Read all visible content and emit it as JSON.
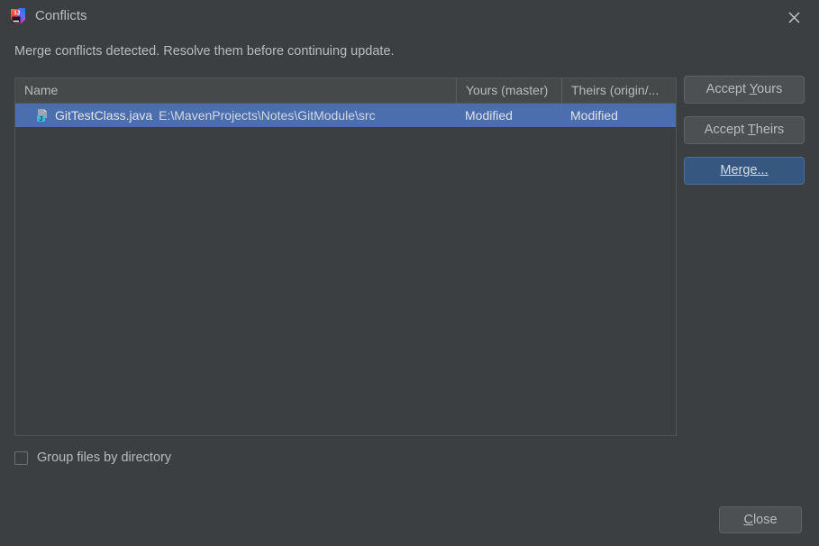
{
  "window": {
    "title": "Conflicts",
    "app_icon": "intellij-idea-icon",
    "close_icon": "close-icon"
  },
  "message": "Merge conflicts detected. Resolve them before continuing update.",
  "table": {
    "columns": [
      {
        "label": "Name"
      },
      {
        "label": "Yours (master)"
      },
      {
        "label": "Theirs (origin/..."
      }
    ],
    "rows": [
      {
        "icon": "java-file-icon",
        "file_name": "GitTestClass.java",
        "file_path": "E:\\MavenProjects\\Notes\\GitModule\\src",
        "yours": "Modified",
        "theirs": "Modified",
        "selected": true
      }
    ]
  },
  "side_buttons": {
    "accept_yours": {
      "before": "Accept ",
      "mnemonic": "Y",
      "after": "ours"
    },
    "accept_theirs": {
      "before": "Accept ",
      "mnemonic": "T",
      "after": "heirs"
    },
    "merge": {
      "before": "",
      "mnemonic": "Merge...",
      "after": ""
    }
  },
  "footer": {
    "group_files_label": "Group files by directory",
    "group_files_checked": false,
    "close": {
      "mnemonic": "C",
      "after": "lose"
    }
  },
  "colors": {
    "background": "#3c3f41",
    "selection": "#4b6eaf",
    "default_button": "#365880",
    "text": "#bbbbbb"
  }
}
